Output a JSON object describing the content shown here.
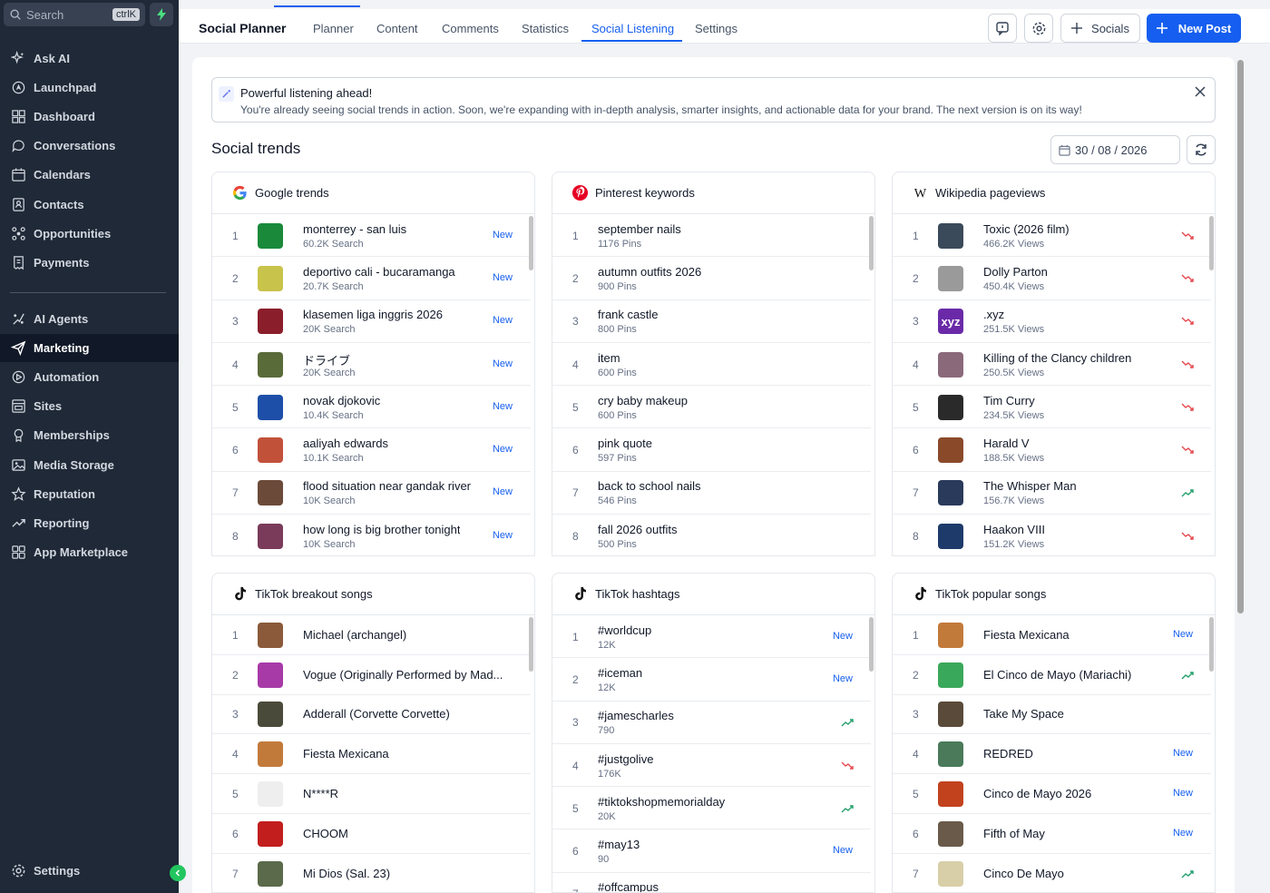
{
  "sidebar": {
    "search_placeholder": "Search",
    "search_shortcut": "ctrlK",
    "items": [
      {
        "label": "Ask AI",
        "icon": "sparkle-icon"
      },
      {
        "label": "Launchpad",
        "icon": "rocket-icon"
      },
      {
        "label": "Dashboard",
        "icon": "grid-icon"
      },
      {
        "label": "Conversations",
        "icon": "chat-icon"
      },
      {
        "label": "Calendars",
        "icon": "calendar-icon"
      },
      {
        "label": "Contacts",
        "icon": "contacts-icon"
      },
      {
        "label": "Opportunities",
        "icon": "pipeline-icon"
      },
      {
        "label": "Payments",
        "icon": "receipt-icon"
      },
      {
        "label": "AI Agents",
        "icon": "agent-icon"
      },
      {
        "label": "Marketing",
        "icon": "send-icon"
      },
      {
        "label": "Automation",
        "icon": "automation-icon"
      },
      {
        "label": "Sites",
        "icon": "sites-icon"
      },
      {
        "label": "Memberships",
        "icon": "membership-icon"
      },
      {
        "label": "Media Storage",
        "icon": "image-icon"
      },
      {
        "label": "Reputation",
        "icon": "star-icon"
      },
      {
        "label": "Reporting",
        "icon": "trend-icon"
      },
      {
        "label": "App Marketplace",
        "icon": "apps-icon"
      }
    ],
    "active_item": "Marketing",
    "settings_label": "Settings"
  },
  "header": {
    "title": "Social Planner",
    "tabs": [
      "Planner",
      "Content",
      "Comments",
      "Statistics",
      "Social Listening",
      "Settings"
    ],
    "active_tab": "Social Listening",
    "socials_label": "Socials",
    "new_post_label": "New Post"
  },
  "banner": {
    "title": "Powerful listening ahead!",
    "text": "You're already seeing social trends in action. Soon, we're expanding with in-depth analysis, smarter insights, and actionable data for your brand. The next version is on its way!"
  },
  "section": {
    "title": "Social trends",
    "date": "30 / 08 / 2026"
  },
  "colors": {
    "accent": "#155eef",
    "trend_up": "#22a06b",
    "trend_down": "#e5484d",
    "sidebar_bg": "#1f2937"
  },
  "cards": [
    {
      "id": "google",
      "title": "Google trends",
      "logo": "google-logo-icon",
      "rows": [
        {
          "rank": "1",
          "name": "monterrey - san luis",
          "meta": "60.2K Search",
          "badge": "New",
          "thumb": "#1a8a3a"
        },
        {
          "rank": "2",
          "name": "deportivo cali - bucaramanga",
          "meta": "20.7K Search",
          "badge": "New",
          "thumb": "#c8c34a"
        },
        {
          "rank": "3",
          "name": "klasemen liga inggris 2026",
          "meta": "20K Search",
          "badge": "New",
          "thumb": "#8b1e2b"
        },
        {
          "rank": "4",
          "name": "ドライブ",
          "meta": "20K Search",
          "badge": "New",
          "thumb": "#5a6b3a"
        },
        {
          "rank": "5",
          "name": "novak djokovic",
          "meta": "10.4K Search",
          "badge": "New",
          "thumb": "#1e4fa8"
        },
        {
          "rank": "6",
          "name": "aaliyah edwards",
          "meta": "10.1K Search",
          "badge": "New",
          "thumb": "#c2513a"
        },
        {
          "rank": "7",
          "name": "flood situation near gandak river",
          "meta": "10K Search",
          "badge": "New",
          "thumb": "#6b4a3a"
        },
        {
          "rank": "8",
          "name": "how long is big brother tonight",
          "meta": "10K Search",
          "badge": "New",
          "thumb": "#7a3a5a"
        }
      ]
    },
    {
      "id": "pinterest",
      "title": "Pinterest keywords",
      "logo": "pinterest-logo-icon",
      "rows": [
        {
          "rank": "1",
          "name": "september nails",
          "meta": "1176 Pins"
        },
        {
          "rank": "2",
          "name": "autumn outfits 2026",
          "meta": "900 Pins"
        },
        {
          "rank": "3",
          "name": "frank castle",
          "meta": "800 Pins"
        },
        {
          "rank": "4",
          "name": "item",
          "meta": "600 Pins"
        },
        {
          "rank": "5",
          "name": "cry baby makeup",
          "meta": "600 Pins"
        },
        {
          "rank": "6",
          "name": "pink quote",
          "meta": "597 Pins"
        },
        {
          "rank": "7",
          "name": "back to school nails",
          "meta": "546 Pins"
        },
        {
          "rank": "8",
          "name": "fall 2026 outfits",
          "meta": "500 Pins"
        }
      ]
    },
    {
      "id": "wikipedia",
      "title": "Wikipedia pageviews",
      "logo": "wikipedia-logo-icon",
      "rows": [
        {
          "rank": "1",
          "name": "Toxic (2026 film)",
          "meta": "466.2K Views",
          "trend": "down",
          "thumb": "#3a4a5a"
        },
        {
          "rank": "2",
          "name": "Dolly Parton",
          "meta": "450.4K Views",
          "trend": "down",
          "thumb": "#9a9a9a"
        },
        {
          "rank": "3",
          "name": ".xyz",
          "meta": "251.5K Views",
          "trend": "down",
          "thumb": "#6a2aa8",
          "thumb_text": "xyz"
        },
        {
          "rank": "4",
          "name": "Killing of the Clancy children",
          "meta": "250.5K Views",
          "trend": "down",
          "thumb": "#8a6a7a"
        },
        {
          "rank": "5",
          "name": "Tim Curry",
          "meta": "234.5K Views",
          "trend": "down",
          "thumb": "#2a2a2a"
        },
        {
          "rank": "6",
          "name": "Harald V",
          "meta": "188.5K Views",
          "trend": "down",
          "thumb": "#8a4a2a"
        },
        {
          "rank": "7",
          "name": "The Whisper Man",
          "meta": "156.7K Views",
          "trend": "up",
          "thumb": "#2a3a5a"
        },
        {
          "rank": "8",
          "name": "Haakon VIII",
          "meta": "151.2K Views",
          "trend": "down",
          "thumb": "#1e3a6a"
        }
      ]
    },
    {
      "id": "tiktok-breakout",
      "title": "TikTok breakout songs",
      "logo": "tiktok-logo-icon",
      "rows": [
        {
          "rank": "1",
          "name": "Michael (archangel)",
          "thumb": "#8a5a3a"
        },
        {
          "rank": "2",
          "name": "Vogue (Originally Performed by Mad...",
          "thumb": "#a83aa8"
        },
        {
          "rank": "3",
          "name": "Adderall (Corvette Corvette)",
          "thumb": "#4a4a3a"
        },
        {
          "rank": "4",
          "name": "Fiesta Mexicana",
          "thumb": "#c27a3a"
        },
        {
          "rank": "5",
          "name": "N****R",
          "thumb": "#eeeeee"
        },
        {
          "rank": "6",
          "name": "CHOOM",
          "thumb": "#c21e1e"
        },
        {
          "rank": "7",
          "name": "Mi Dios (Sal. 23)",
          "thumb": "#5a6a4a"
        }
      ]
    },
    {
      "id": "tiktok-hashtags",
      "title": "TikTok hashtags",
      "logo": "tiktok-logo-icon",
      "rows": [
        {
          "rank": "1",
          "name": "#worldcup",
          "meta": "12K",
          "badge": "New"
        },
        {
          "rank": "2",
          "name": "#iceman",
          "meta": "12K",
          "badge": "New"
        },
        {
          "rank": "3",
          "name": "#jamescharles",
          "meta": "790",
          "trend": "up"
        },
        {
          "rank": "4",
          "name": "#justgolive",
          "meta": "176K",
          "trend": "down"
        },
        {
          "rank": "5",
          "name": "#tiktokshopmemorialday",
          "meta": "20K",
          "trend": "up"
        },
        {
          "rank": "6",
          "name": "#may13",
          "meta": "90",
          "badge": "New"
        },
        {
          "rank": "7",
          "name": "#offcampus",
          "meta": ""
        }
      ]
    },
    {
      "id": "tiktok-popular",
      "title": "TikTok popular songs",
      "logo": "tiktok-logo-icon",
      "rows": [
        {
          "rank": "1",
          "name": "Fiesta Mexicana",
          "badge": "New",
          "thumb": "#c27a3a"
        },
        {
          "rank": "2",
          "name": "El Cinco de Mayo (Mariachi)",
          "trend": "up",
          "thumb": "#3aa85a"
        },
        {
          "rank": "3",
          "name": "Take My Space",
          "thumb": "#5a4a3a"
        },
        {
          "rank": "4",
          "name": "REDRED",
          "badge": "New",
          "thumb": "#4a7a5a"
        },
        {
          "rank": "5",
          "name": "Cinco de Mayo 2026",
          "badge": "New",
          "thumb": "#c2421e"
        },
        {
          "rank": "6",
          "name": "Fifth of May",
          "badge": "New",
          "thumb": "#6a5a4a"
        },
        {
          "rank": "7",
          "name": "Cinco De Mayo",
          "trend": "up",
          "thumb": "#d8cfa8"
        }
      ]
    }
  ]
}
